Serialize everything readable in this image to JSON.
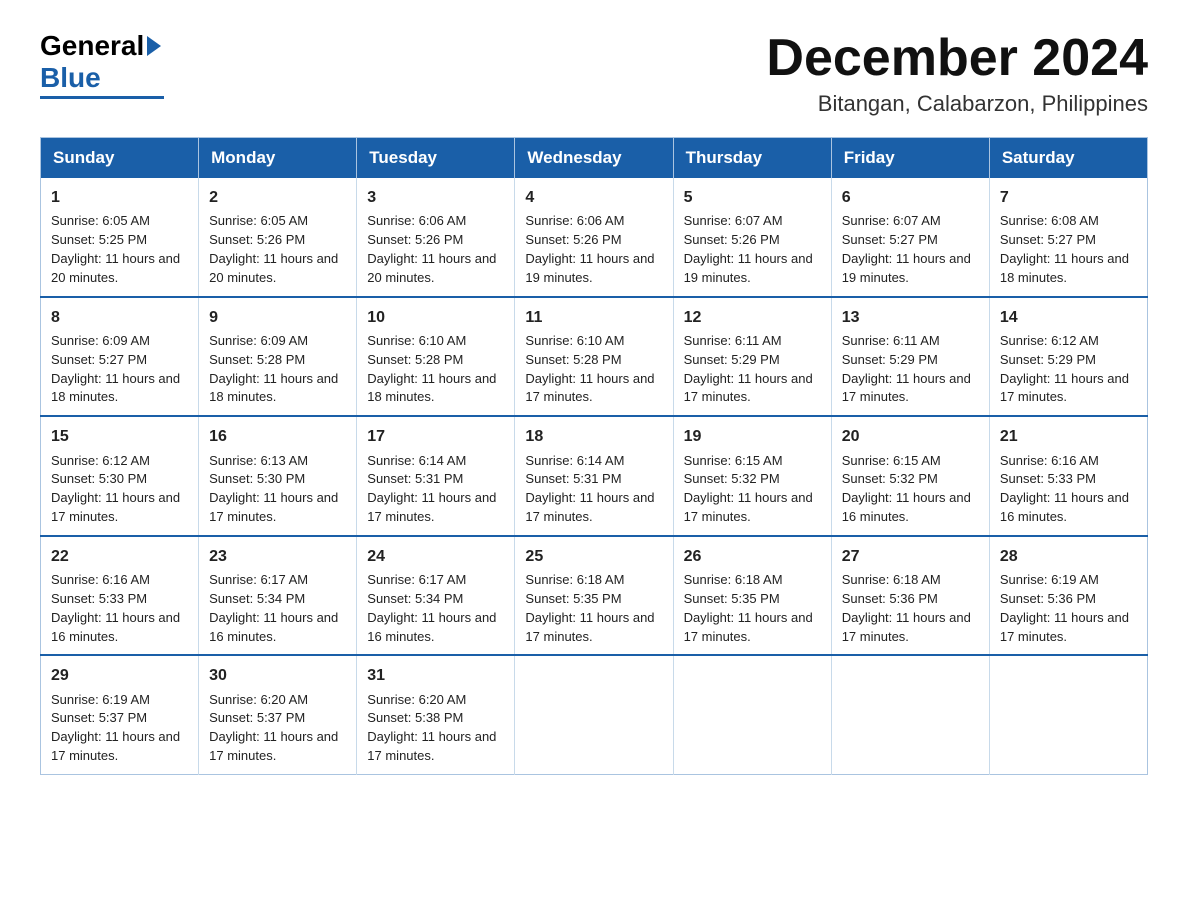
{
  "header": {
    "logo": {
      "general": "General",
      "blue": "Blue"
    },
    "month_title": "December 2024",
    "location": "Bitangan, Calabarzon, Philippines"
  },
  "weekdays": [
    "Sunday",
    "Monday",
    "Tuesday",
    "Wednesday",
    "Thursday",
    "Friday",
    "Saturday"
  ],
  "weeks": [
    [
      {
        "day": "1",
        "sunrise": "6:05 AM",
        "sunset": "5:25 PM",
        "daylight": "11 hours and 20 minutes."
      },
      {
        "day": "2",
        "sunrise": "6:05 AM",
        "sunset": "5:26 PM",
        "daylight": "11 hours and 20 minutes."
      },
      {
        "day": "3",
        "sunrise": "6:06 AM",
        "sunset": "5:26 PM",
        "daylight": "11 hours and 20 minutes."
      },
      {
        "day": "4",
        "sunrise": "6:06 AM",
        "sunset": "5:26 PM",
        "daylight": "11 hours and 19 minutes."
      },
      {
        "day": "5",
        "sunrise": "6:07 AM",
        "sunset": "5:26 PM",
        "daylight": "11 hours and 19 minutes."
      },
      {
        "day": "6",
        "sunrise": "6:07 AM",
        "sunset": "5:27 PM",
        "daylight": "11 hours and 19 minutes."
      },
      {
        "day": "7",
        "sunrise": "6:08 AM",
        "sunset": "5:27 PM",
        "daylight": "11 hours and 18 minutes."
      }
    ],
    [
      {
        "day": "8",
        "sunrise": "6:09 AM",
        "sunset": "5:27 PM",
        "daylight": "11 hours and 18 minutes."
      },
      {
        "day": "9",
        "sunrise": "6:09 AM",
        "sunset": "5:28 PM",
        "daylight": "11 hours and 18 minutes."
      },
      {
        "day": "10",
        "sunrise": "6:10 AM",
        "sunset": "5:28 PM",
        "daylight": "11 hours and 18 minutes."
      },
      {
        "day": "11",
        "sunrise": "6:10 AM",
        "sunset": "5:28 PM",
        "daylight": "11 hours and 17 minutes."
      },
      {
        "day": "12",
        "sunrise": "6:11 AM",
        "sunset": "5:29 PM",
        "daylight": "11 hours and 17 minutes."
      },
      {
        "day": "13",
        "sunrise": "6:11 AM",
        "sunset": "5:29 PM",
        "daylight": "11 hours and 17 minutes."
      },
      {
        "day": "14",
        "sunrise": "6:12 AM",
        "sunset": "5:29 PM",
        "daylight": "11 hours and 17 minutes."
      }
    ],
    [
      {
        "day": "15",
        "sunrise": "6:12 AM",
        "sunset": "5:30 PM",
        "daylight": "11 hours and 17 minutes."
      },
      {
        "day": "16",
        "sunrise": "6:13 AM",
        "sunset": "5:30 PM",
        "daylight": "11 hours and 17 minutes."
      },
      {
        "day": "17",
        "sunrise": "6:14 AM",
        "sunset": "5:31 PM",
        "daylight": "11 hours and 17 minutes."
      },
      {
        "day": "18",
        "sunrise": "6:14 AM",
        "sunset": "5:31 PM",
        "daylight": "11 hours and 17 minutes."
      },
      {
        "day": "19",
        "sunrise": "6:15 AM",
        "sunset": "5:32 PM",
        "daylight": "11 hours and 17 minutes."
      },
      {
        "day": "20",
        "sunrise": "6:15 AM",
        "sunset": "5:32 PM",
        "daylight": "11 hours and 16 minutes."
      },
      {
        "day": "21",
        "sunrise": "6:16 AM",
        "sunset": "5:33 PM",
        "daylight": "11 hours and 16 minutes."
      }
    ],
    [
      {
        "day": "22",
        "sunrise": "6:16 AM",
        "sunset": "5:33 PM",
        "daylight": "11 hours and 16 minutes."
      },
      {
        "day": "23",
        "sunrise": "6:17 AM",
        "sunset": "5:34 PM",
        "daylight": "11 hours and 16 minutes."
      },
      {
        "day": "24",
        "sunrise": "6:17 AM",
        "sunset": "5:34 PM",
        "daylight": "11 hours and 16 minutes."
      },
      {
        "day": "25",
        "sunrise": "6:18 AM",
        "sunset": "5:35 PM",
        "daylight": "11 hours and 17 minutes."
      },
      {
        "day": "26",
        "sunrise": "6:18 AM",
        "sunset": "5:35 PM",
        "daylight": "11 hours and 17 minutes."
      },
      {
        "day": "27",
        "sunrise": "6:18 AM",
        "sunset": "5:36 PM",
        "daylight": "11 hours and 17 minutes."
      },
      {
        "day": "28",
        "sunrise": "6:19 AM",
        "sunset": "5:36 PM",
        "daylight": "11 hours and 17 minutes."
      }
    ],
    [
      {
        "day": "29",
        "sunrise": "6:19 AM",
        "sunset": "5:37 PM",
        "daylight": "11 hours and 17 minutes."
      },
      {
        "day": "30",
        "sunrise": "6:20 AM",
        "sunset": "5:37 PM",
        "daylight": "11 hours and 17 minutes."
      },
      {
        "day": "31",
        "sunrise": "6:20 AM",
        "sunset": "5:38 PM",
        "daylight": "11 hours and 17 minutes."
      },
      null,
      null,
      null,
      null
    ]
  ],
  "labels": {
    "sunrise": "Sunrise:",
    "sunset": "Sunset:",
    "daylight": "Daylight:"
  }
}
